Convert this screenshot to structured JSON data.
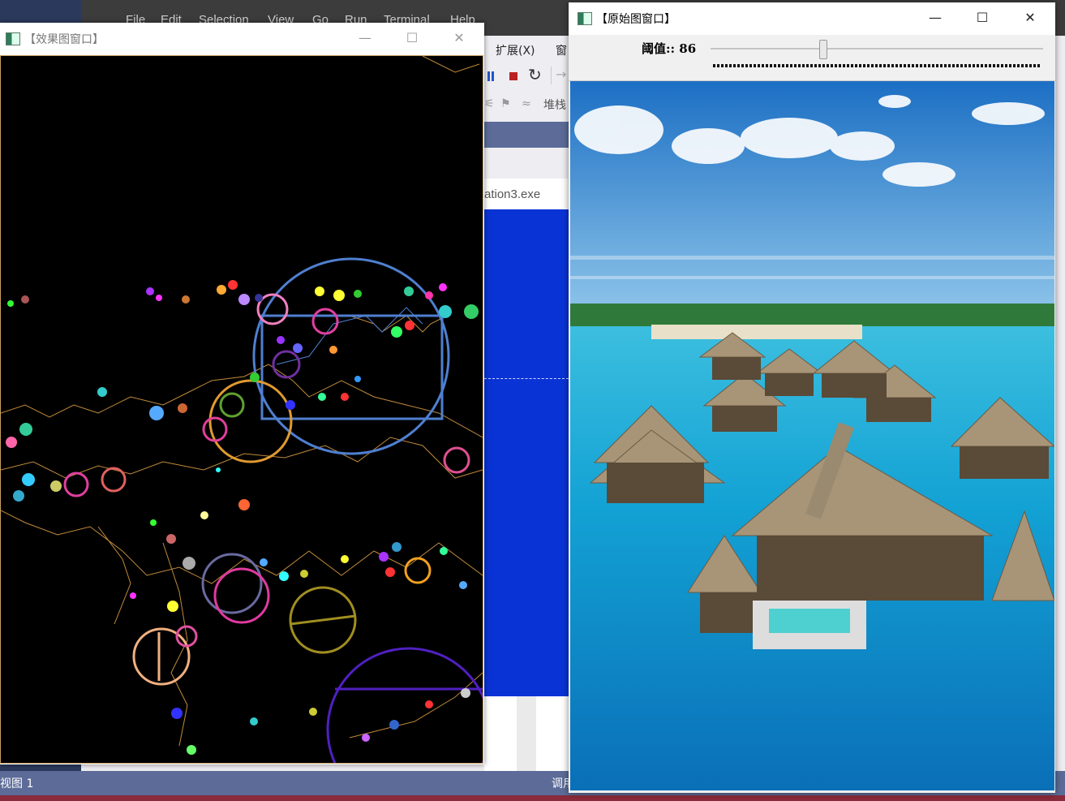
{
  "ide": {
    "menu": [
      "File",
      "Edit",
      "Selection",
      "View",
      "Go",
      "Run",
      "Terminal",
      "Help"
    ],
    "menu_cn": [
      "扩展(X)",
      "窗"
    ],
    "stack_label": "堆栈",
    "doc_tab": "ation3.exe",
    "status_left": "视图 1",
    "status_right": "调用"
  },
  "effect_window": {
    "title": "【效果图窗口】",
    "min": "—",
    "max": "☐",
    "close": "✕"
  },
  "original_window": {
    "title": "【原始图窗口】",
    "min": "—",
    "max": "☐",
    "close": "✕",
    "slider_label": "阈值:: 86",
    "slider_value": 86,
    "slider_max": 255
  }
}
